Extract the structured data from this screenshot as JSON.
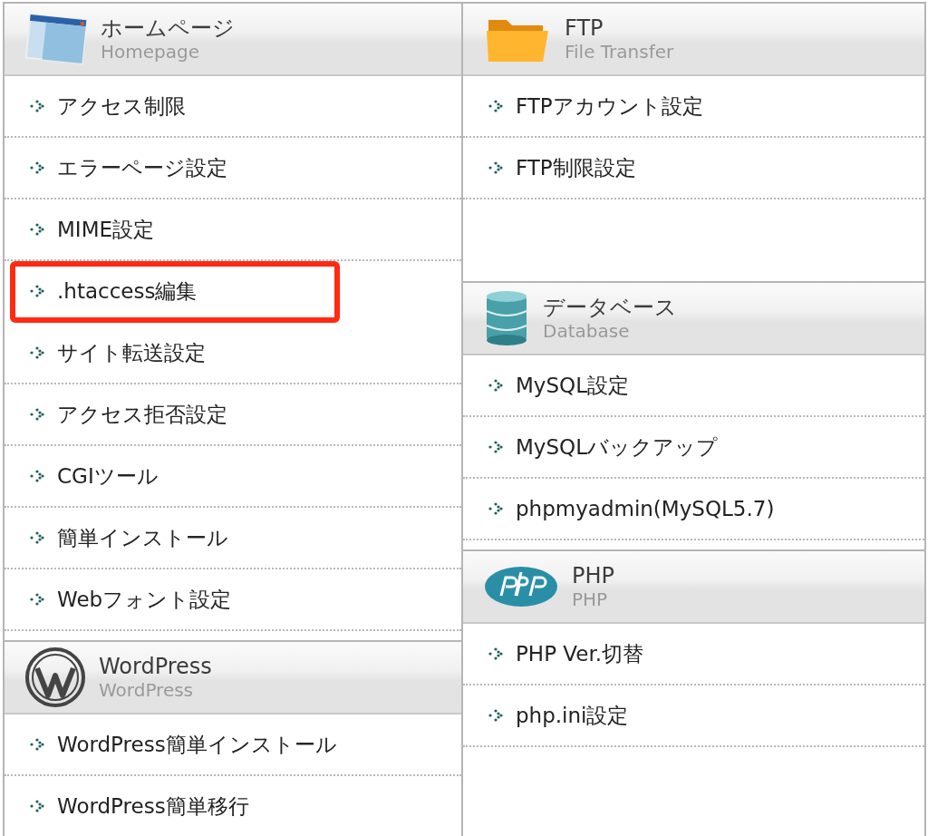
{
  "columns": [
    {
      "sections": [
        {
          "kind": "homepage",
          "title": "ホームページ",
          "subtitle": "Homepage",
          "items": [
            {
              "label": "アクセス制限",
              "highlighted": false
            },
            {
              "label": "エラーページ設定",
              "highlighted": false
            },
            {
              "label": "MIME設定",
              "highlighted": false
            },
            {
              "label": ".htaccess編集",
              "highlighted": true
            },
            {
              "label": "サイト転送設定",
              "highlighted": false
            },
            {
              "label": "アクセス拒否設定",
              "highlighted": false
            },
            {
              "label": "CGIツール",
              "highlighted": false
            },
            {
              "label": "簡単インストール",
              "highlighted": false
            },
            {
              "label": "Webフォント設定",
              "highlighted": false
            }
          ]
        },
        {
          "kind": "wordpress",
          "title": "WordPress",
          "subtitle": "WordPress",
          "items": [
            {
              "label": "WordPress簡単インストール",
              "highlighted": false
            },
            {
              "label": "WordPress簡単移行",
              "highlighted": false
            }
          ]
        }
      ]
    },
    {
      "sections": [
        {
          "kind": "ftp",
          "title": "FTP",
          "subtitle": "File Transfer",
          "items": [
            {
              "label": "FTPアカウント設定",
              "highlighted": false
            },
            {
              "label": "FTP制限設定",
              "highlighted": false
            }
          ]
        },
        {
          "kind": "database",
          "title": "データベース",
          "subtitle": "Database",
          "items": [
            {
              "label": "MySQL設定",
              "highlighted": false
            },
            {
              "label": "MySQLバックアップ",
              "highlighted": false
            },
            {
              "label": "phpmyadmin(MySQL5.7)",
              "highlighted": false
            }
          ]
        },
        {
          "kind": "php",
          "title": "PHP",
          "subtitle": "PHP",
          "items": [
            {
              "label": "PHP Ver.切替",
              "highlighted": false
            },
            {
              "label": "php.ini設定",
              "highlighted": false
            }
          ]
        }
      ]
    }
  ]
}
